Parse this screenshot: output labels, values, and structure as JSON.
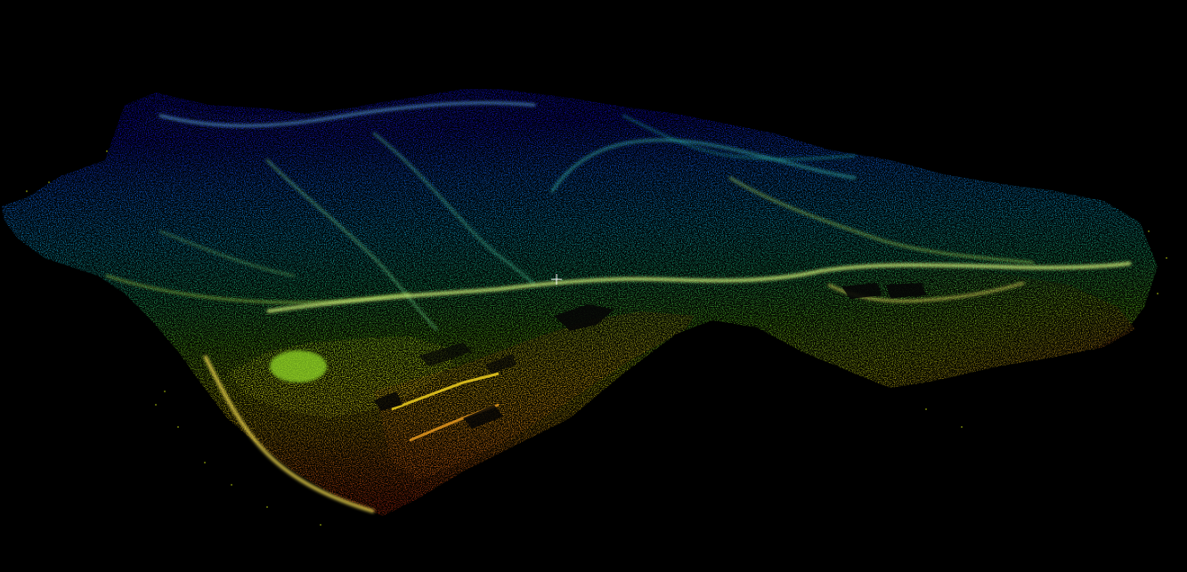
{
  "viewer": {
    "background_color": "#000000",
    "colormap": [
      "#1010e0",
      "#1070ff",
      "#10c0d0",
      "#20d070",
      "#60e020",
      "#c8e010",
      "#e0c010",
      "#e08010",
      "#d83010"
    ],
    "cursor_color": "#ffffff",
    "cursor_icon": "crosshair-icon"
  }
}
